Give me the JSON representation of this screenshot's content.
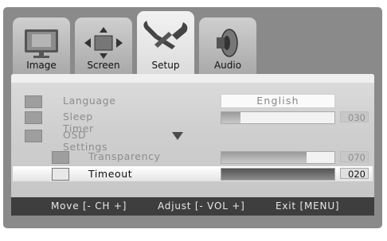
{
  "tabs": [
    {
      "label": "Image",
      "icon": "tv-icon"
    },
    {
      "label": "Screen",
      "icon": "screen-arrows-icon"
    },
    {
      "label": "Setup",
      "icon": "tools-icon"
    },
    {
      "label": "Audio",
      "icon": "speaker-icon"
    }
  ],
  "active_tab": "Setup",
  "settings": {
    "language": {
      "label": "Language",
      "value": "English"
    },
    "sleep_timer": {
      "label": "Sleep Timer",
      "value": "030",
      "level": 0.17
    },
    "osd_settings": {
      "label": "OSD  Settings",
      "expanded": true
    },
    "transparency": {
      "label": "Transparency",
      "value": "070",
      "level": 0.75
    },
    "timeout": {
      "label": "Timeout",
      "value": "020",
      "level": 1.0,
      "selected": true
    }
  },
  "footer": {
    "move": "Move [- CH +]",
    "adjust": "Adjust [- VOL +]",
    "exit": "Exit [MENU]"
  },
  "colors": {
    "panel": "#8a8a8a",
    "footer": "#3e3e3e",
    "selected_text": "#111111",
    "dim_text": "#8d8d8d"
  }
}
